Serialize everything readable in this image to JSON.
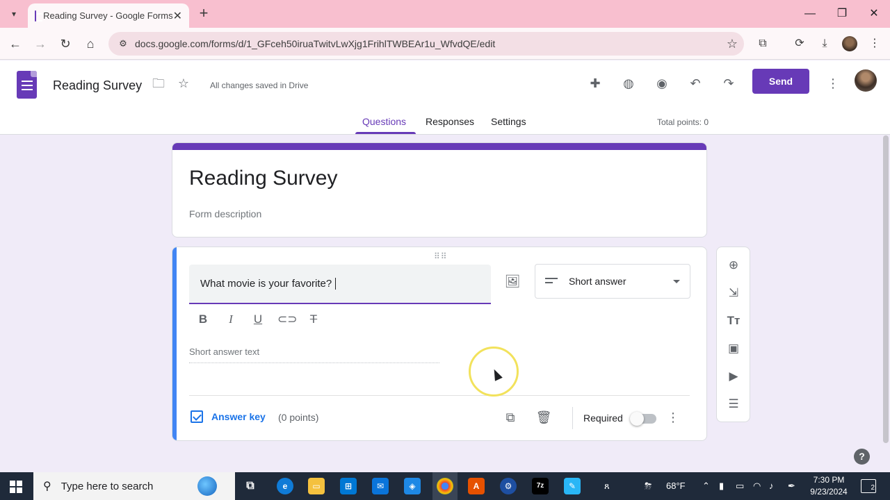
{
  "browser": {
    "tab_title": "Reading Survey - Google Forms",
    "url": "docs.google.com/forms/d/1_GFceh50iruaTwitvLwXjg1FrihlTWBEAr1u_WfvdQE/edit"
  },
  "header": {
    "doc_title": "Reading Survey",
    "saved_status": "All changes saved in Drive",
    "send_label": "Send",
    "tabs": [
      {
        "label": "Questions",
        "active": true
      },
      {
        "label": "Responses",
        "active": false
      },
      {
        "label": "Settings",
        "active": false
      }
    ],
    "total_points": "Total points: 0"
  },
  "form": {
    "title": "Reading Survey",
    "description_placeholder": "Form description"
  },
  "question": {
    "text": "What movie is your favorite?",
    "type": "Short answer",
    "answer_placeholder": "Short answer text",
    "answer_key_label": "Answer key",
    "points": "(0 points)",
    "required_label": "Required",
    "required": false
  },
  "taskbar": {
    "search_placeholder": "Type here to search",
    "weather": "68°F",
    "time": "7:30 PM",
    "date": "9/23/2024",
    "notification_count": "2"
  },
  "colors": {
    "brand_purple": "#673ab7",
    "active_question_accent": "#4285f4",
    "link_blue": "#1a73e8"
  }
}
